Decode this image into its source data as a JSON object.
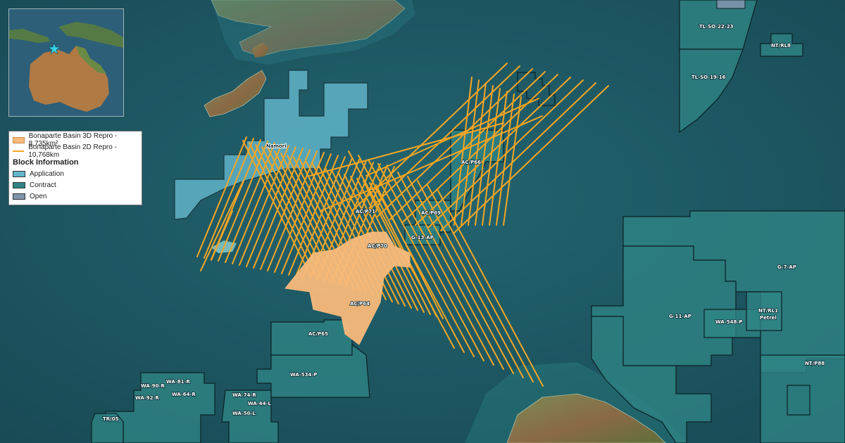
{
  "legend": {
    "items": [
      {
        "label": "Bonaparte Basin 3D Repro - 8,735km²",
        "color": "#f8b97a",
        "kind": "fill"
      },
      {
        "label": "Bonaparte Basin 2D Repro - 10,768km",
        "color": "#f5a623",
        "kind": "line"
      }
    ],
    "block_heading": "Block Information",
    "block_items": [
      {
        "label": "Application",
        "color": "#63b6cc"
      },
      {
        "label": "Contract",
        "color": "#2f8585"
      },
      {
        "label": "Open",
        "color": "#7f94ad"
      }
    ]
  },
  "blocks": {
    "namori": "Namori",
    "ac_p66": "AC/P66",
    "ac_p71": "AC/P71",
    "ac_p69": "AC/P69",
    "g13ap": "G-13-AP",
    "ac_p70": "AC/P70",
    "ac_p64": "AC/P64",
    "ac_p65": "AC/P65",
    "wa534p": "WA-534-P",
    "wa81r": "WA-81-R",
    "wa90r": "WA-90-R",
    "wa64r": "WA-64-R",
    "wa92r": "WA-92-R",
    "wa74r": "WA-74-R",
    "wa44l": "WA-44-L",
    "wa50l": "WA-50-L",
    "tr05": "TR/05",
    "tlso2223": "TL-SO-22-23",
    "tlso1916": "TL-SO-19-16",
    "ntrl8": "NT/RL8",
    "g7ap": "G-7-AP",
    "g11ap": "G-11-AP",
    "wa548p": "WA-548-P",
    "ntrl1": "NT/RL1",
    "petrel": "Petrel",
    "ntp88": "NT/P88"
  },
  "colors": {
    "ocean": "#1f5b66",
    "application": "#63b6cc",
    "contract": "#2f8585",
    "open": "#7f94ad",
    "survey2d": "#f5a623",
    "survey3d": "#f8b97a",
    "land": "#6f7a4a",
    "star": "#37d1e8"
  },
  "inset": {
    "marker": "star-marker"
  }
}
